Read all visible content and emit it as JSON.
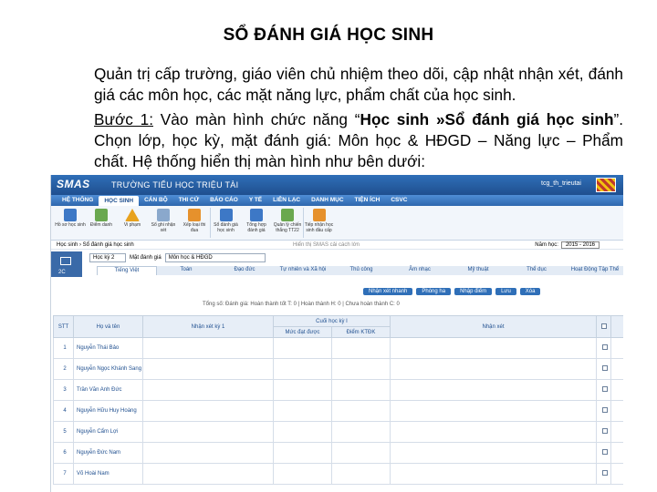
{
  "title": "SỔ ĐÁNH GIÁ HỌC SINH",
  "paragraph1": "Quản trị cấp trường, giáo viên chủ nhiệm theo dõi, cập nhật nhận xét, đánh giá các môn học, các mặt năng lực, phẩm chất của học sinh.",
  "step": {
    "label": "Bước 1:",
    "text_a": " Vào màn hình chức năng “",
    "bold_path": "Học sinh »Sổ đánh giá học sinh",
    "text_b": "”. Chọn lớp, học kỳ, mặt đánh giá: Môn học & HĐGD – Năng lực – Phẩm chất. Hệ thống hiển thị màn hình như bên dưới:"
  },
  "screenshot": {
    "logo": "SMAS",
    "school_name": "TRƯỜNG TIỂU HỌC TRIỆU TÀI",
    "user": "tcg_th_trieutai",
    "menu": [
      "HỆ THỐNG",
      "HỌC SINH",
      "CÁN BỘ",
      "THI CỬ",
      "BÁO CÁO",
      "Y TẾ",
      "LIÊN LẠC",
      "DANH MỤC",
      "TIỆN ÍCH",
      "CSVC"
    ],
    "toolbar": [
      "Hồ sơ học sinh",
      "Điểm danh",
      "Vi phạm",
      "Sổ ghi nhận xét",
      "Xếp loại thi đua",
      "Sổ đánh giá học sinh",
      "Tổng hợp đánh giá",
      "Quản lý chiến thắng TT22",
      "Tiếp nhận học sinh đầu cấp"
    ],
    "breadcrumb": "Học sinh › Sổ đánh giá học sinh",
    "hint": "Hiển thị SMAS cải cách lớn",
    "year_label": "Năm học:",
    "year": "2015 - 2016",
    "side_label": "2C",
    "filters": [
      "Học kỳ 2",
      "Mặt đánh giá",
      "Môn học & HĐGD"
    ],
    "subjects": [
      "Tiếng Việt",
      "Toán",
      "Đạo đức",
      "Tự nhiên và Xã hội",
      "Thủ công",
      "Âm nhạc",
      "Mỹ thuật",
      "Thể dục",
      "Hoạt Động Tập Thể"
    ],
    "buttons": [
      "Nhận xét nhanh",
      "Phòng ha",
      "Nhập điểm",
      "Lưu",
      "Xóa"
    ],
    "status": "Tổng số: Đánh giá: Hoàn thành tốt T: 0 | Hoàn thành H: 0 | Chưa hoàn thành C: 0",
    "columns": {
      "stt": "STT",
      "name": "Họ và tên",
      "hk1": "Nhận xét kỳ 1",
      "final": "Cuối học kỳ I",
      "level": "Mức đạt được",
      "score": "Điểm KTĐK",
      "comment": "Nhận xét"
    },
    "students": [
      {
        "stt": "1",
        "name": "Nguyễn Thái Bảo"
      },
      {
        "stt": "2",
        "name": "Nguyễn Ngọc Khánh Sang"
      },
      {
        "stt": "3",
        "name": "Trần Văn Anh Đức"
      },
      {
        "stt": "4",
        "name": "Nguyễn Hữu Huy Hoàng"
      },
      {
        "stt": "5",
        "name": "Nguyễn Cẩm Lợi"
      },
      {
        "stt": "6",
        "name": "Nguyễn Đức Nam"
      },
      {
        "stt": "7",
        "name": "Võ Hoài Nam"
      }
    ]
  }
}
